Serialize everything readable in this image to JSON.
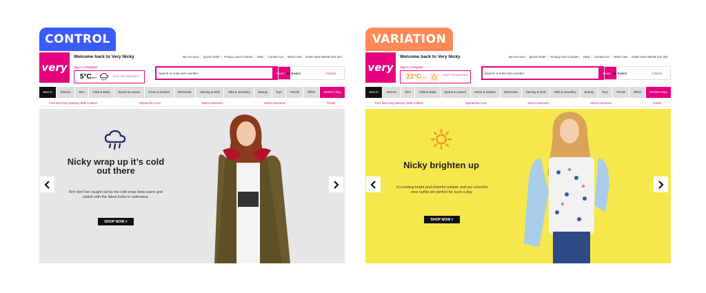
{
  "labels": {
    "control": "CONTROL",
    "variation": "VARIATION"
  },
  "colors": {
    "control_badge": "#3b5bff",
    "variation_badge": "#ff8a57",
    "brand_pink": "#e6007e",
    "control_hero_bg": "#e6e6e8",
    "variation_hero_bg": "#f6e74c",
    "variation_weather": "#f7941d"
  },
  "header": {
    "logo": "very",
    "welcome": "Welcome back to Very Nicky",
    "signin": "Sign in | Register",
    "shop_for": "SHOP FOR WEATHER >",
    "top_links": [
      "My Account",
      "Quick Order",
      "Privacy and Cookies",
      "Help",
      "Contact Us",
      "Wish Lists"
    ],
    "order_now": "Order Now 08448 222 321",
    "search_placeholder": "Search or enter item number",
    "search_button": "Search",
    "basket_label": "Your Basket",
    "basket_items": "0 items"
  },
  "nav": [
    "New In",
    "Women",
    "Men",
    "Child & Baby",
    "Sports & Leisure",
    "Home & Garden",
    "Electricals",
    "Gaming & DVD",
    "Gifts & Jewellery",
    "Beauty",
    "Toys",
    "Trends",
    "Offers",
    "Mother's Day"
  ],
  "promos": [
    "Free Next Day Delivery With Collect+",
    "Spread the Cost",
    "New Customers",
    "Home Insurance",
    "Treats"
  ],
  "control": {
    "temperature": "5°C",
    "temp_unit": "MIN",
    "weather_icon": "cloud-rain-icon",
    "hero_title": "Nicky wrap up it’s cold out there",
    "hero_body": "Brrr don’t be caught out by the cold snap keep warm and stylish with the latest looks in outerwear.",
    "cta": "SHOP NOW >"
  },
  "variation": {
    "temperature": "22°C",
    "temp_unit": "MIN",
    "weather_icon": "sun-icon",
    "hero_title": "Nicky brighten up",
    "hero_body": "It’s looking bright and cheerful outside and our colourful new outfits are perfect for such a day.",
    "cta": "SHOP NOW >"
  }
}
